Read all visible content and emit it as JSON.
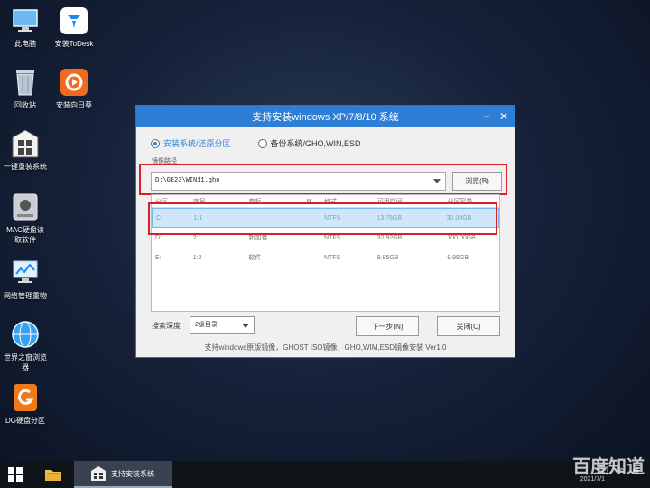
{
  "desktop": {
    "icons": [
      {
        "label": "此电脑",
        "icon": "computer-icon"
      },
      {
        "label": "安装ToDesk",
        "icon": "todesk-icon"
      },
      {
        "label": "回收站",
        "icon": "recycle-bin-icon"
      },
      {
        "label": "安装向日葵",
        "icon": "sunflower-icon"
      },
      {
        "label": "一键重装系统",
        "icon": "reinstall-icon"
      },
      {
        "label": "MAC硬盘读",
        "label2": "取软件",
        "icon": "mac-disk-icon"
      },
      {
        "label": "网络管理重物",
        "icon": "network-icon"
      },
      {
        "label": "世界之窗浏览",
        "label2": "器",
        "icon": "browser-icon"
      },
      {
        "label": "DG硬盘分区",
        "icon": "diskgenius-icon"
      }
    ]
  },
  "window": {
    "title": "支持安装windows XP/7/8/10 系统",
    "minimize": "−",
    "close": "✕",
    "radio_install": "安装系统/还原分区",
    "radio_backup": "备份系统/GHO,WIN,ESD",
    "path_label": "镜像路径",
    "path_value": "D:\\GE23\\WIN11.gho",
    "browse_label": "浏览(B)",
    "columns": [
      "分区",
      "序号",
      "卷标",
      "Ⅲ",
      "格式",
      "可用空间",
      "分区容量"
    ],
    "rows": [
      {
        "drive": "C:",
        "index": "1:1",
        "label": "",
        "format": "NTFS",
        "free": "13.78GB",
        "size": "30.00GB",
        "selected": true
      },
      {
        "drive": "D:",
        "index": "2:1",
        "label": "新加卷",
        "format": "NTFS",
        "free": "32.92GB",
        "size": "100.00GB",
        "selected": false
      },
      {
        "drive": "E:",
        "index": "1:2",
        "label": "软件",
        "format": "NTFS",
        "free": "9.85GB",
        "size": "9.99GB",
        "selected": false
      }
    ],
    "depth_label": "搜索深度",
    "depth_value": "2级目录",
    "next_button": "下一步(N)",
    "close_button": "关闭(C)",
    "footer": "支持windows原版镜像，GHOST ISO镜像，GHO,WIM,ESD镜像安装 Ver1.0"
  },
  "taskbar": {
    "task_label": "支持安装系统",
    "date": "2021/7/1"
  },
  "watermark": "百度知道",
  "colors": {
    "accent": "#2e7ed6",
    "highlight": "#d6202a"
  }
}
